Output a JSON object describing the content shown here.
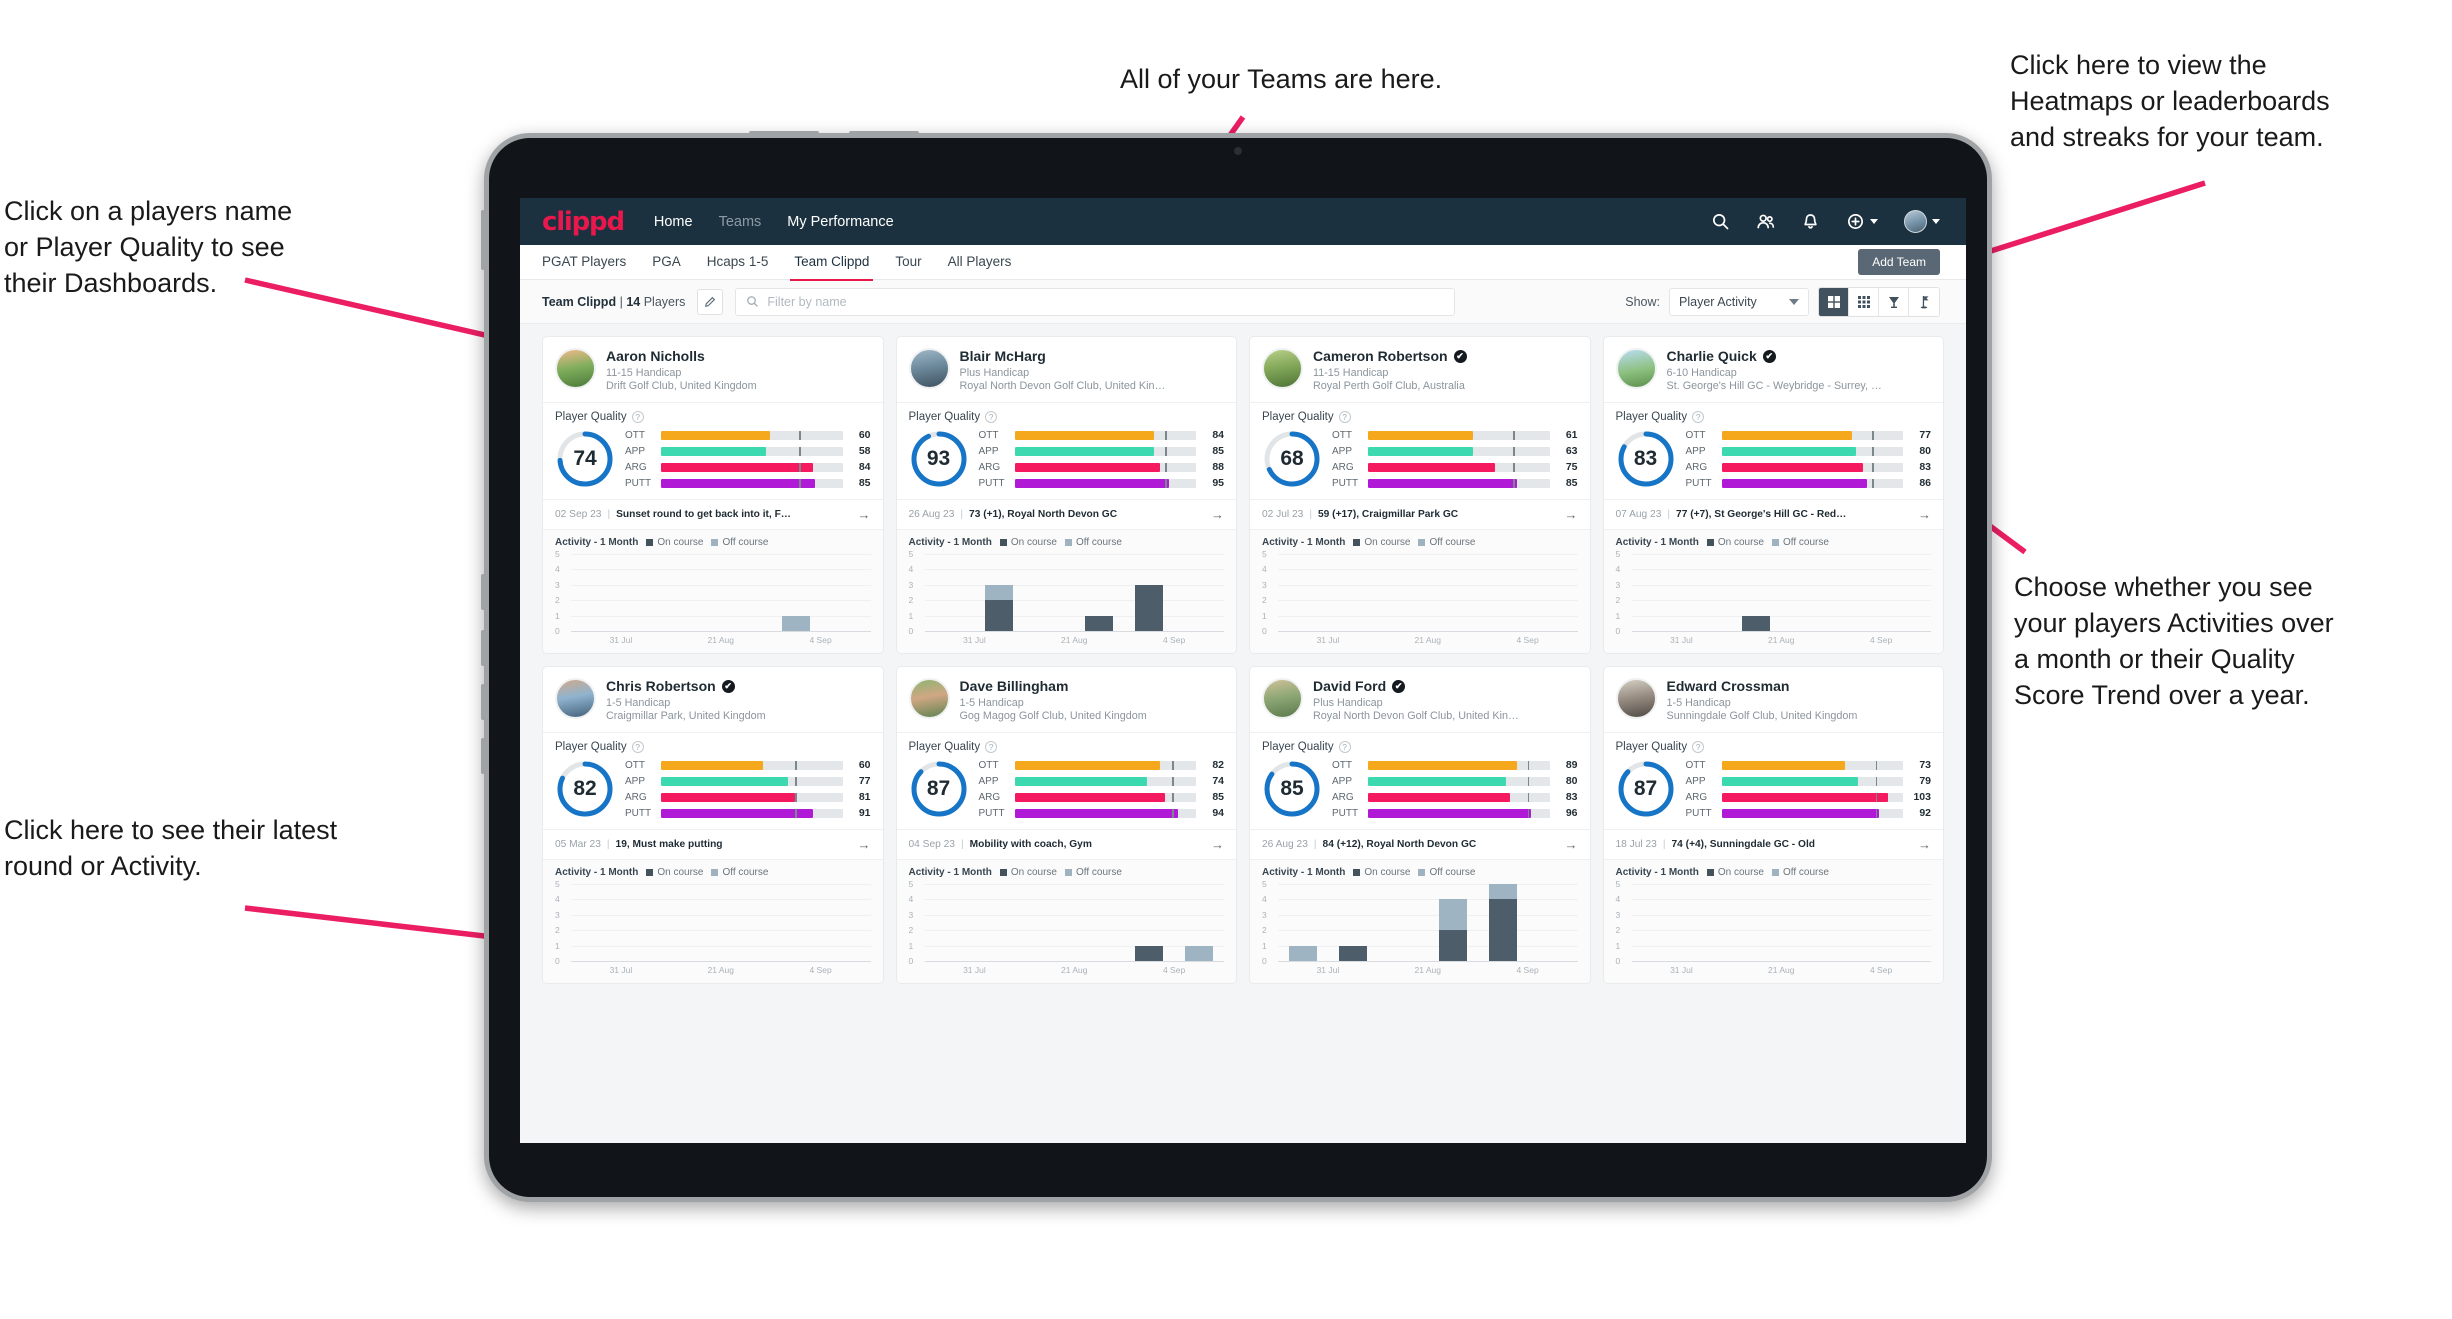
{
  "annotations": [
    {
      "id": "teams",
      "text": "All of your Teams are here."
    },
    {
      "id": "heatmaps",
      "text": "Click here to view the\nHeatmaps or leaderboards\nand streaks for your team."
    },
    {
      "id": "players",
      "text": "Click on a players name\nor Player Quality to see\ntheir Dashboards."
    },
    {
      "id": "activity-choice",
      "text": "Choose whether you see\nyour players Activities over\na month or their Quality\nScore Trend over a year."
    },
    {
      "id": "latest-round",
      "text": "Click here to see their latest\nround or Activity."
    }
  ],
  "app": {
    "brand": "clippd",
    "nav_links": [
      {
        "label": "Home",
        "active": true
      },
      {
        "label": "Teams",
        "active": false
      },
      {
        "label": "My Performance",
        "active": true
      }
    ],
    "nav_icons": [
      "search-icon",
      "people-icon",
      "bell-icon",
      "plus-circle-icon",
      "avatar"
    ],
    "subtabs": [
      {
        "label": "PGAT Players",
        "active": false
      },
      {
        "label": "PGA",
        "active": false
      },
      {
        "label": "Hcaps 1-5",
        "active": false
      },
      {
        "label": "Team Clippd",
        "active": true
      },
      {
        "label": "Tour",
        "active": false
      },
      {
        "label": "All Players",
        "active": false
      }
    ],
    "add_team_label": "Add Team"
  },
  "filterbar": {
    "team_name": "Team Clippd",
    "team_count": "14",
    "team_count_suffix": "Players",
    "separator": "|",
    "edit_icon": "pencil-icon",
    "search_placeholder": "Filter by name",
    "show_label": "Show:",
    "show_value": "Player Activity",
    "view_buttons": [
      "grid-large-icon",
      "grid-small-icon",
      "trophy-icon",
      "flag-icon"
    ],
    "active_view": 0
  },
  "labels": {
    "player_quality": "Player Quality",
    "activity_title": "Activity - 1 Month",
    "legend_on": "On course",
    "legend_off": "Off course",
    "metric_names": [
      "OTT",
      "APP",
      "ARG",
      "PUTT"
    ],
    "y_ticks": [
      "5",
      "4",
      "3",
      "2",
      "1",
      "0"
    ],
    "x_ticks": [
      "31 Jul",
      "21 Aug",
      "4 Sep"
    ]
  },
  "colors": {
    "brand": "#e8174c",
    "nav_bg": "#1c313f",
    "ring": "#1675c6",
    "ott": "#f5a81c",
    "app": "#3cd9b0",
    "arg": "#f5195f",
    "putt": "#b01ad6",
    "on_course": "#4d5e6a",
    "off_course": "#9fb4c2"
  },
  "chart_data": {
    "type": "bar",
    "title": "Activity - 1 Month",
    "ylabel": "",
    "xlabel": "",
    "ylim": [
      0,
      5
    ],
    "categories": [
      "31 Jul",
      "21 Aug",
      "4 Sep"
    ],
    "series": [
      {
        "name": "On course",
        "color": "#4d5e6a"
      },
      {
        "name": "Off course",
        "color": "#9fb4c2"
      }
    ],
    "grid": true,
    "legend": "top"
  },
  "players": [
    {
      "name": "Aaron Nicholls",
      "verified": false,
      "handicap": "11-15 Handicap",
      "club": "Drift Golf Club, United Kingdom",
      "quality": "74",
      "quality_pct": 74,
      "metrics": [
        {
          "label": "OTT",
          "value": "60",
          "pct": 60,
          "tick": 76
        },
        {
          "label": "APP",
          "value": "58",
          "pct": 58,
          "tick": 76
        },
        {
          "label": "ARG",
          "value": "84",
          "pct": 84,
          "tick": 76
        },
        {
          "label": "PUTT",
          "value": "85",
          "pct": 85,
          "tick": 76
        }
      ],
      "round_date": "02 Sep 23",
      "round_text": "Sunset round to get back into it, F…",
      "activity": [
        {
          "on": 0,
          "off": 0
        },
        {
          "on": 0,
          "off": 0
        },
        {
          "on": 0,
          "off": 0
        },
        {
          "on": 0,
          "off": 0
        },
        {
          "on": 0,
          "off": 1
        },
        {
          "on": 0,
          "off": 0
        }
      ]
    },
    {
      "name": "Blair McHarg",
      "verified": false,
      "handicap": "Plus Handicap",
      "club": "Royal North Devon Golf Club, United Kin…",
      "quality": "93",
      "quality_pct": 93,
      "metrics": [
        {
          "label": "OTT",
          "value": "84",
          "pct": 77,
          "tick": 83
        },
        {
          "label": "APP",
          "value": "85",
          "pct": 77,
          "tick": 83
        },
        {
          "label": "ARG",
          "value": "88",
          "pct": 80,
          "tick": 83
        },
        {
          "label": "PUTT",
          "value": "95",
          "pct": 85,
          "tick": 83
        }
      ],
      "round_date": "26 Aug 23",
      "round_text": "73 (+1), Royal North Devon GC",
      "activity": [
        {
          "on": 0,
          "off": 0
        },
        {
          "on": 2,
          "off": 1
        },
        {
          "on": 0,
          "off": 0
        },
        {
          "on": 1,
          "off": 0
        },
        {
          "on": 3,
          "off": 0
        },
        {
          "on": 0,
          "off": 0
        }
      ]
    },
    {
      "name": "Cameron Robertson",
      "verified": true,
      "handicap": "11-15 Handicap",
      "club": "Royal Perth Golf Club, Australia",
      "quality": "68",
      "quality_pct": 68,
      "metrics": [
        {
          "label": "OTT",
          "value": "61",
          "pct": 58,
          "tick": 80
        },
        {
          "label": "APP",
          "value": "63",
          "pct": 58,
          "tick": 80
        },
        {
          "label": "ARG",
          "value": "75",
          "pct": 70,
          "tick": 80
        },
        {
          "label": "PUTT",
          "value": "85",
          "pct": 82,
          "tick": 80
        }
      ],
      "round_date": "02 Jul 23",
      "round_text": "59 (+17), Craigmillar Park GC",
      "activity": [
        {
          "on": 0,
          "off": 0
        },
        {
          "on": 0,
          "off": 0
        },
        {
          "on": 0,
          "off": 0
        },
        {
          "on": 0,
          "off": 0
        },
        {
          "on": 0,
          "off": 0
        },
        {
          "on": 0,
          "off": 0
        }
      ]
    },
    {
      "name": "Charlie Quick",
      "verified": true,
      "handicap": "6-10 Handicap",
      "club": "St. George's Hill GC - Weybridge - Surrey, …",
      "quality": "83",
      "quality_pct": 83,
      "metrics": [
        {
          "label": "OTT",
          "value": "77",
          "pct": 72,
          "tick": 83
        },
        {
          "label": "APP",
          "value": "80",
          "pct": 74,
          "tick": 83
        },
        {
          "label": "ARG",
          "value": "83",
          "pct": 78,
          "tick": 83
        },
        {
          "label": "PUTT",
          "value": "86",
          "pct": 80,
          "tick": 83
        }
      ],
      "round_date": "07 Aug 23",
      "round_text": "77 (+7), St George's Hill GC - Red…",
      "activity": [
        {
          "on": 0,
          "off": 0
        },
        {
          "on": 0,
          "off": 0
        },
        {
          "on": 1,
          "off": 0
        },
        {
          "on": 0,
          "off": 0
        },
        {
          "on": 0,
          "off": 0
        },
        {
          "on": 0,
          "off": 0
        }
      ]
    },
    {
      "name": "Chris Robertson",
      "verified": true,
      "handicap": "1-5 Handicap",
      "club": "Craigmillar Park, United Kingdom",
      "quality": "82",
      "quality_pct": 82,
      "metrics": [
        {
          "label": "OTT",
          "value": "60",
          "pct": 56,
          "tick": 74
        },
        {
          "label": "APP",
          "value": "77",
          "pct": 70,
          "tick": 74
        },
        {
          "label": "ARG",
          "value": "81",
          "pct": 74,
          "tick": 74
        },
        {
          "label": "PUTT",
          "value": "91",
          "pct": 84,
          "tick": 74
        }
      ],
      "round_date": "05 Mar 23",
      "round_text": "19, Must make putting",
      "activity": [
        {
          "on": 0,
          "off": 0
        },
        {
          "on": 0,
          "off": 0
        },
        {
          "on": 0,
          "off": 0
        },
        {
          "on": 0,
          "off": 0
        },
        {
          "on": 0,
          "off": 0
        },
        {
          "on": 0,
          "off": 0
        }
      ]
    },
    {
      "name": "Dave Billingham",
      "verified": false,
      "handicap": "1-5 Handicap",
      "club": "Gog Magog Golf Club, United Kingdom",
      "quality": "87",
      "quality_pct": 87,
      "metrics": [
        {
          "label": "OTT",
          "value": "82",
          "pct": 80,
          "tick": 87
        },
        {
          "label": "APP",
          "value": "74",
          "pct": 73,
          "tick": 87
        },
        {
          "label": "ARG",
          "value": "85",
          "pct": 83,
          "tick": 87
        },
        {
          "label": "PUTT",
          "value": "94",
          "pct": 90,
          "tick": 87
        }
      ],
      "round_date": "04 Sep 23",
      "round_text": "Mobility with coach, Gym",
      "activity": [
        {
          "on": 0,
          "off": 0
        },
        {
          "on": 0,
          "off": 0
        },
        {
          "on": 0,
          "off": 0
        },
        {
          "on": 0,
          "off": 0
        },
        {
          "on": 1,
          "off": 0
        },
        {
          "on": 0,
          "off": 1
        }
      ]
    },
    {
      "name": "David Ford",
      "verified": true,
      "handicap": "Plus Handicap",
      "club": "Royal North Devon Golf Club, United Kin…",
      "quality": "85",
      "quality_pct": 85,
      "metrics": [
        {
          "label": "OTT",
          "value": "89",
          "pct": 82,
          "tick": 88
        },
        {
          "label": "APP",
          "value": "80",
          "pct": 76,
          "tick": 88
        },
        {
          "label": "ARG",
          "value": "83",
          "pct": 78,
          "tick": 88
        },
        {
          "label": "PUTT",
          "value": "96",
          "pct": 90,
          "tick": 88
        }
      ],
      "round_date": "26 Aug 23",
      "round_text": "84 (+12), Royal North Devon GC",
      "activity": [
        {
          "on": 0,
          "off": 1
        },
        {
          "on": 1,
          "off": 0
        },
        {
          "on": 0,
          "off": 0
        },
        {
          "on": 2,
          "off": 2
        },
        {
          "on": 4,
          "off": 1
        },
        {
          "on": 0,
          "off": 0
        }
      ]
    },
    {
      "name": "Edward Crossman",
      "verified": false,
      "handicap": "1-5 Handicap",
      "club": "Sunningdale Golf Club, United Kingdom",
      "quality": "87",
      "quality_pct": 87,
      "metrics": [
        {
          "label": "OTT",
          "value": "73",
          "pct": 68,
          "tick": 85
        },
        {
          "label": "APP",
          "value": "79",
          "pct": 75,
          "tick": 85
        },
        {
          "label": "ARG",
          "value": "103",
          "pct": 92,
          "tick": 85
        },
        {
          "label": "PUTT",
          "value": "92",
          "pct": 87,
          "tick": 85
        }
      ],
      "round_date": "18 Jul 23",
      "round_text": "74 (+4), Sunningdale GC - Old",
      "activity": [
        {
          "on": 0,
          "off": 0
        },
        {
          "on": 0,
          "off": 0
        },
        {
          "on": 0,
          "off": 0
        },
        {
          "on": 0,
          "off": 0
        },
        {
          "on": 0,
          "off": 0
        },
        {
          "on": 0,
          "off": 0
        }
      ]
    }
  ]
}
